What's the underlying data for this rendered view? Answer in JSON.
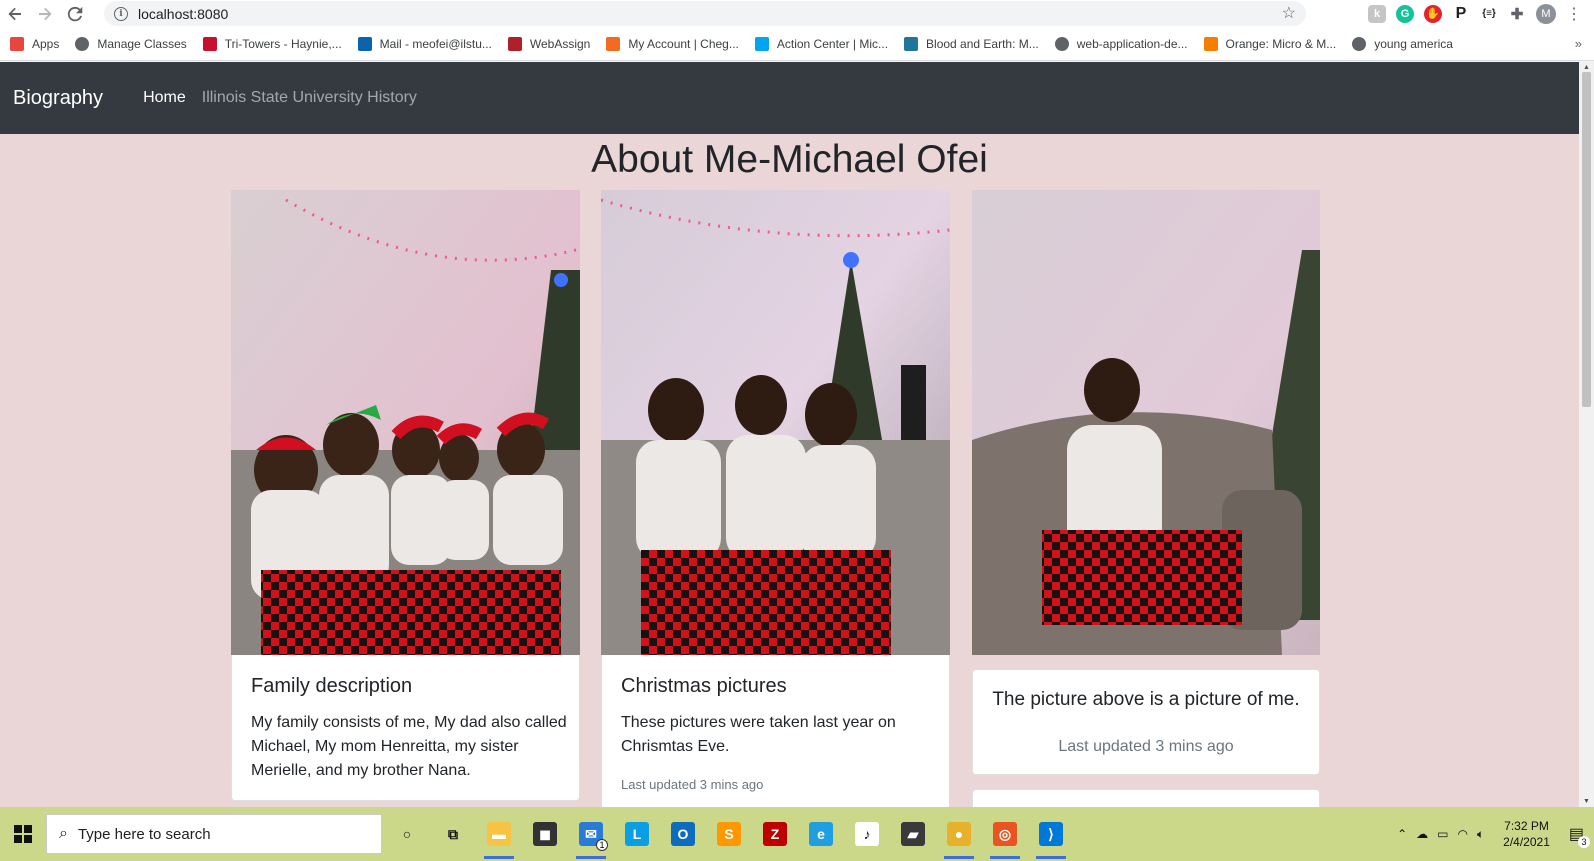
{
  "browser": {
    "url": "localhost:8080",
    "profile_initial": "M",
    "bookmarks": [
      {
        "label": "Apps",
        "icon": "apps-grid-icon",
        "color": "#e8453c"
      },
      {
        "label": "Manage Classes",
        "icon": "globe-icon",
        "color": "#5f6368"
      },
      {
        "label": "Tri-Towers - Haynie,...",
        "icon": "cardinal-icon",
        "color": "#c8102e"
      },
      {
        "label": "Mail - meofei@ilstu...",
        "icon": "outlook-icon",
        "color": "#0a64ad"
      },
      {
        "label": "WebAssign",
        "icon": "webassign-icon",
        "color": "#b0202a"
      },
      {
        "label": "My Account | Cheg...",
        "icon": "chegg-icon",
        "color": "#f26b21"
      },
      {
        "label": "Action Center | Mic...",
        "icon": "microsoft-icon",
        "color": "#00a4ef"
      },
      {
        "label": "Blood and Earth: M...",
        "icon": "wordpress-icon",
        "color": "#21759b"
      },
      {
        "label": "web-application-de...",
        "icon": "globe-icon",
        "color": "#5f6368"
      },
      {
        "label": "Orange: Micro & M...",
        "icon": "blogger-icon",
        "color": "#f57d00"
      },
      {
        "label": "young america",
        "icon": "globe-icon",
        "color": "#5f6368"
      }
    ],
    "more_bookmarks": "»"
  },
  "page": {
    "brand": "Biography",
    "nav": [
      {
        "label": "Home",
        "active": true
      },
      {
        "label": "Illinois State University History",
        "active": false
      }
    ],
    "heading": "About Me-Michael Ofei",
    "cards": [
      {
        "title": "Family description",
        "text": "My family consists of me, My dad also called Michael, My mom Henreitta, my sister Merielle, and my brother Nana.",
        "photo": "Family of five in matching Tis the Season pajamas and Santa hats by a Christmas tree"
      },
      {
        "title": "Christmas pictures",
        "text": "These pictures were taken last year on Chrismtas Eve.",
        "footer": "Last updated 3 mins ago",
        "photo": "Three family members in matching pajamas seated on a couch by a Christmas tree"
      },
      {
        "text": "The picture above is a picture of me.",
        "footer": "Last updated 3 mins ago",
        "photo": "Michael seated on a couch in Christmas pajamas by a tree"
      }
    ]
  },
  "taskbar": {
    "search_placeholder": "Type here to search",
    "time": "7:32 PM",
    "date": "2/4/2021",
    "notification_count": "3",
    "mail_badge": "1",
    "apps": [
      {
        "name": "cortana-icon",
        "glyph": "○",
        "color": "transparent"
      },
      {
        "name": "task-view-icon",
        "glyph": "⧉",
        "color": "transparent"
      },
      {
        "name": "file-explorer-icon",
        "glyph": "▬",
        "color": "#f6c344"
      },
      {
        "name": "store-icon",
        "glyph": "◼",
        "color": "#333"
      },
      {
        "name": "mail-icon",
        "glyph": "✉",
        "color": "#2a7bd6"
      },
      {
        "name": "lync-icon",
        "glyph": "L",
        "color": "#0a9fe3"
      },
      {
        "name": "outlook-icon",
        "glyph": "O",
        "color": "#0f6cbd"
      },
      {
        "name": "sublime-icon",
        "glyph": "S",
        "color": "#ff9800"
      },
      {
        "name": "filezilla-icon",
        "glyph": "Z",
        "color": "#bf0000"
      },
      {
        "name": "edge-icon",
        "glyph": "e",
        "color": "#1f9fe0"
      },
      {
        "name": "itunes-icon",
        "glyph": "♪",
        "color": "#fff"
      },
      {
        "name": "sticky-notes-icon",
        "glyph": "▰",
        "color": "#3a3a3a"
      },
      {
        "name": "chrome-icon",
        "glyph": "●",
        "color": "#e7b12b"
      },
      {
        "name": "ubuntu-icon",
        "glyph": "◎",
        "color": "#e95420"
      },
      {
        "name": "vscode-icon",
        "glyph": "⟩",
        "color": "#0078d7"
      }
    ]
  }
}
